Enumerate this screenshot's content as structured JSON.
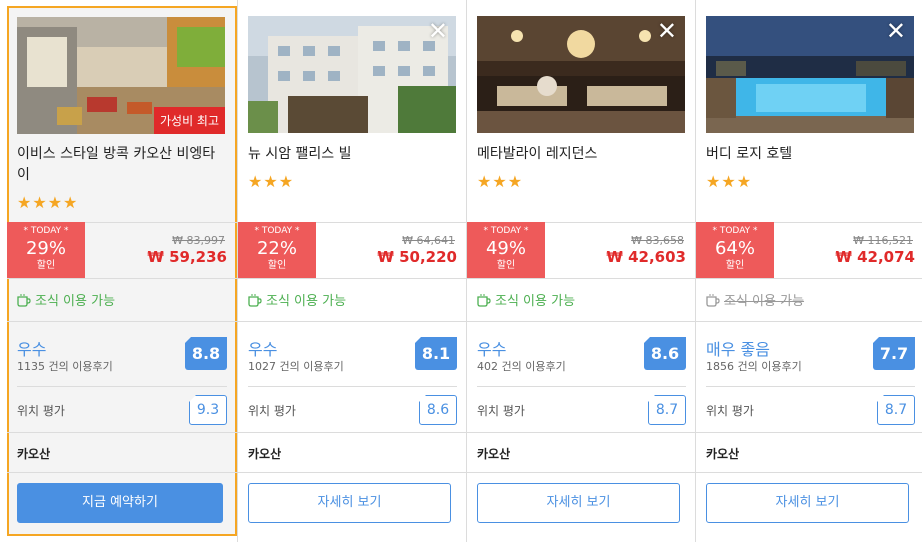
{
  "hotels": [
    {
      "name": "이비스 스타일 방콕 카오산 비엥타이",
      "stars": "★★★",
      "badge": "가성비 최고",
      "today_label": "* TODAY *",
      "discount": "29%",
      "discount_word": "할인",
      "price_old": "₩ 83,997",
      "price_new": "₩ 59,236",
      "breakfast": "조식 이용 가능",
      "rating_word": "우수",
      "reviews": "1135 건의 이용후기",
      "score": "8.8",
      "location_label": "위치 평가",
      "location_score": "9.3",
      "area": "카오산",
      "button": "지금 예약하기"
    },
    {
      "name": "뉴 시암 팰리스 빌",
      "stars": "★★★",
      "close": "✕",
      "today_label": "* TODAY *",
      "discount": "22%",
      "discount_word": "할인",
      "price_old": "₩ 64,641",
      "price_new": "₩ 50,220",
      "breakfast": "조식 이용 가능",
      "rating_word": "우수",
      "reviews": "1027 건의 이용후기",
      "score": "8.1",
      "location_label": "위치 평가",
      "location_score": "8.6",
      "area": "카오산",
      "button": "자세히 보기"
    },
    {
      "name": "메타발라이 레지던스",
      "stars": "★★★",
      "close": "✕",
      "today_label": "* TODAY *",
      "discount": "49%",
      "discount_word": "할인",
      "price_old": "₩ 83,658",
      "price_new": "₩ 42,603",
      "breakfast": "조식 이용 가능",
      "rating_word": "우수",
      "reviews": "402 건의 이용후기",
      "score": "8.6",
      "location_label": "위치 평가",
      "location_score": "8.7",
      "area": "카오산",
      "button": "자세히 보기"
    },
    {
      "name": "버디 로지 호텔",
      "stars": "★★★",
      "close": "✕",
      "today_label": "* TODAY *",
      "discount": "64%",
      "discount_word": "할인",
      "price_old": "₩ 116,521",
      "price_new": "₩ 42,074",
      "breakfast": "조식 이용 가능",
      "rating_word": "매우 좋음",
      "reviews": "1856 건의 이용후기",
      "score": "7.7",
      "location_label": "위치 평가",
      "location_score": "8.7",
      "area": "카오산",
      "button": "자세히 보기"
    }
  ],
  "colors": {
    "accent": "#4a90e2",
    "discount": "#ee5a5a",
    "price": "#e02a2a",
    "selected_border": "#f5a623",
    "breakfast": "#4caf50"
  }
}
